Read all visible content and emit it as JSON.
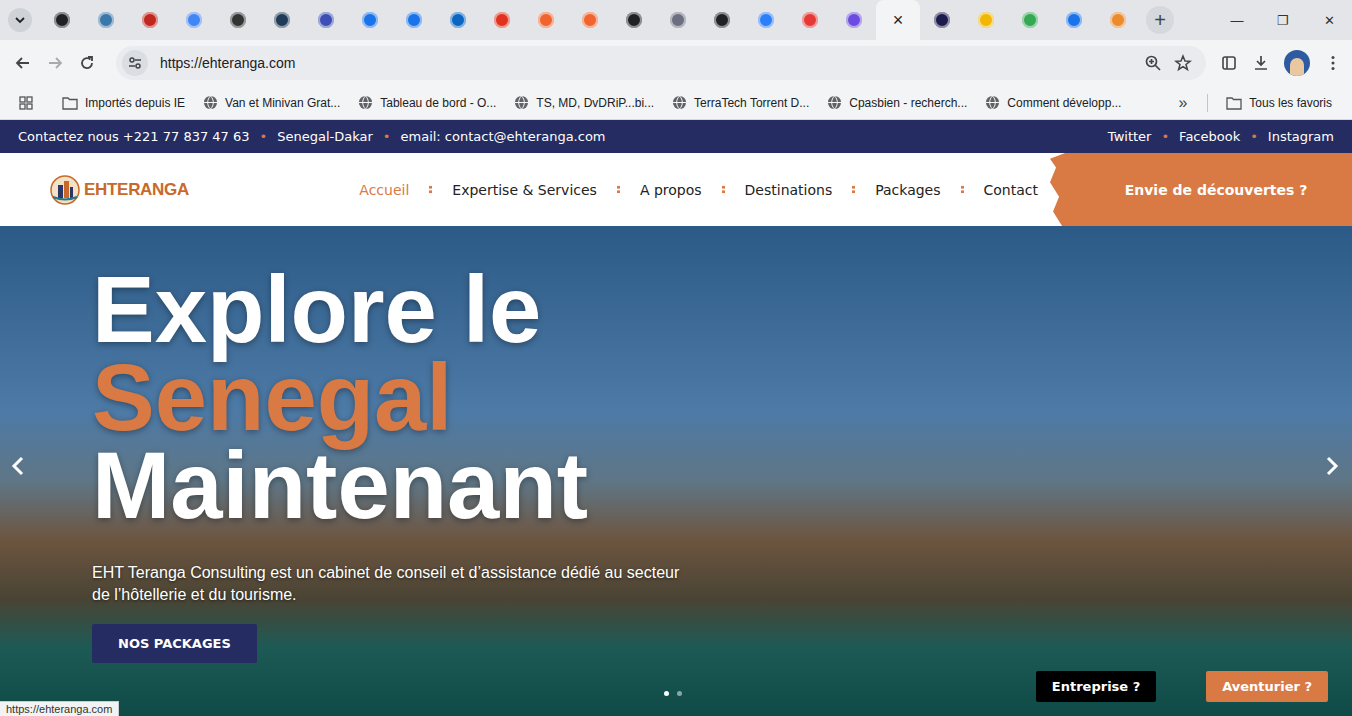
{
  "browser": {
    "tabs": [
      {
        "color": "#202124",
        "selected": false,
        "close": ""
      },
      {
        "color": "#3b77a8",
        "selected": false,
        "close": ""
      },
      {
        "color": "#c0281f",
        "selected": false,
        "close": ""
      },
      {
        "color": "#4285f4",
        "selected": false,
        "close": ""
      },
      {
        "color": "#333333",
        "selected": false,
        "close": ""
      },
      {
        "color": "#1f3b57",
        "selected": false,
        "close": ""
      },
      {
        "color": "#3d4fb5",
        "selected": false,
        "close": ""
      },
      {
        "color": "#1a73e8",
        "selected": false,
        "close": ""
      },
      {
        "color": "#1a73e8",
        "selected": false,
        "close": ""
      },
      {
        "color": "#0a66c2",
        "selected": false,
        "close": ""
      },
      {
        "color": "#e0321f",
        "selected": false,
        "close": ""
      },
      {
        "color": "#f0652f",
        "selected": false,
        "close": ""
      },
      {
        "color": "#f0652f",
        "selected": false,
        "close": ""
      },
      {
        "color": "#202124",
        "selected": false,
        "close": ""
      },
      {
        "color": "#6b6f80",
        "selected": false,
        "close": ""
      },
      {
        "color": "#202124",
        "selected": false,
        "close": ""
      },
      {
        "color": "#2d7ff9",
        "selected": false,
        "close": ""
      },
      {
        "color": "#e53935",
        "selected": false,
        "close": ""
      },
      {
        "color": "#6c4ce0",
        "selected": false,
        "close": ""
      },
      {
        "color": "#ffffff",
        "selected": true,
        "close": "×"
      },
      {
        "color": "#1b1b4d",
        "selected": false,
        "close": ""
      },
      {
        "color": "#f2b705",
        "selected": false,
        "close": ""
      },
      {
        "color": "#34a853",
        "selected": false,
        "close": ""
      },
      {
        "color": "#1a73e8",
        "selected": false,
        "close": ""
      },
      {
        "color": "#ea8b2e",
        "selected": false,
        "close": ""
      }
    ],
    "new_tab": "+",
    "window_controls": [
      "—",
      "❐",
      "✕"
    ],
    "address": "https://ehteranga.com",
    "bookmarks": [
      {
        "label": "Importés depuis IE",
        "kind": "folder"
      },
      {
        "label": "Van et Minivan Grat...",
        "kind": "site"
      },
      {
        "label": "Tableau de bord - O...",
        "kind": "site"
      },
      {
        "label": "TS, MD, DvDRiP...bi...",
        "kind": "site"
      },
      {
        "label": "TerraTech Torrent D...",
        "kind": "site"
      },
      {
        "label": "Cpasbien - recherch...",
        "kind": "site"
      },
      {
        "label": "Comment développ...",
        "kind": "site"
      }
    ],
    "bookmarks_overflow": "»",
    "all_bookmarks": "Tous les favoris",
    "status_url": "https://ehteranga.com"
  },
  "page": {
    "topbar": {
      "contact": "Contactez nous +221 77 837 47 63",
      "location": "Senegal-Dakar",
      "email": "email: contact@ehteranga.com",
      "separator": "•",
      "social": [
        "Twitter",
        "Facebook",
        "Instagram"
      ]
    },
    "logo": "EHTERANGA",
    "nav": [
      {
        "label": "Accueil",
        "selected": true
      },
      {
        "label": "Expertise & Services",
        "selected": false
      },
      {
        "label": "A propos",
        "selected": false
      },
      {
        "label": "Destinations",
        "selected": false
      },
      {
        "label": "Packages",
        "selected": false
      },
      {
        "label": "Contact",
        "selected": false
      }
    ],
    "cta": "Envie de découvertes ?",
    "hero": {
      "lines": [
        {
          "text": "Explore le",
          "accent": false
        },
        {
          "text": "Senegal",
          "accent": true
        },
        {
          "text": "Maintenant",
          "accent": false
        }
      ],
      "subtitle": "EHT Teranga Consulting est un cabinet de conseil et d’assistance dédié au secteur de l’hôtellerie et du tourisme.",
      "button": "NOS PACKAGES",
      "slides": [
        {
          "selected": true
        },
        {
          "selected": false
        }
      ],
      "choices": [
        {
          "label": "Entreprise ?",
          "kind": "dark"
        },
        {
          "label": "Aventurier ?",
          "kind": "accent"
        }
      ]
    }
  }
}
